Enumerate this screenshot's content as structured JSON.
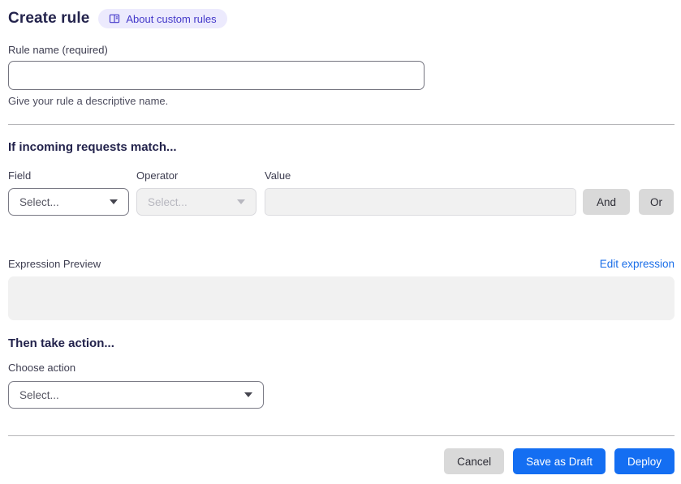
{
  "header": {
    "title": "Create rule",
    "about_badge": {
      "label": "About custom rules",
      "icon": "book-icon"
    }
  },
  "rule_name": {
    "label": "Rule name (required)",
    "value": "",
    "helper": "Give your rule a descriptive name."
  },
  "match_section": {
    "heading": "If incoming requests match...",
    "field": {
      "label": "Field",
      "selected": "Select...",
      "enabled": true
    },
    "operator": {
      "label": "Operator",
      "selected": "Select...",
      "enabled": false
    },
    "value": {
      "label": "Value",
      "value": "",
      "enabled": false
    },
    "and_button": "And",
    "or_button": "Or"
  },
  "expression": {
    "label": "Expression Preview",
    "edit_link": "Edit expression",
    "content": ""
  },
  "action_section": {
    "heading": "Then take action...",
    "choose_label": "Choose action",
    "selected": "Select..."
  },
  "footer": {
    "cancel": "Cancel",
    "save_draft": "Save as Draft",
    "deploy": "Deploy"
  },
  "colors": {
    "heading_text": "#23234c",
    "badge_bg": "#eceafd",
    "badge_text": "#4338c9",
    "link_blue": "#1a6ee8",
    "accent_blue": "#146ef2",
    "button_gray": "#d9d9d9",
    "disabled_bg": "#f1f1f1"
  }
}
